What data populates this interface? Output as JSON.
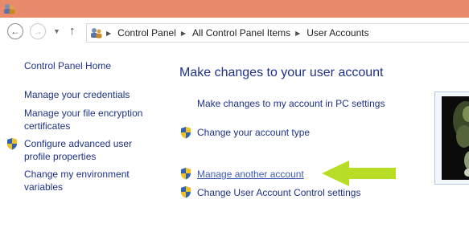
{
  "address": {
    "breadcrumb": [
      "Control Panel",
      "All Control Panel Items",
      "User Accounts"
    ]
  },
  "icons": {
    "titlebar": "user-accounts-icon",
    "back": "back-arrow-icon",
    "forward": "forward-arrow-icon",
    "recent": "chevron-down-icon",
    "up": "up-arrow-icon",
    "shield": "uac-shield-icon",
    "annotation": "green-arrow-icon"
  },
  "sidebar": {
    "home": "Control Panel Home",
    "items": [
      {
        "label": "Manage your credentials"
      },
      {
        "label": "Manage your file encryption certificates"
      },
      {
        "label": "Configure advanced user profile properties"
      },
      {
        "label": "Change my environment variables"
      }
    ]
  },
  "main": {
    "title": "Make changes to your user account",
    "links": [
      {
        "label": "Make changes to my account in PC settings"
      },
      {
        "label": "Change your account type"
      },
      {
        "label": "Manage another account"
      },
      {
        "label": "Change User Account Control settings"
      }
    ]
  },
  "colors": {
    "titlebar": "#ea8a6d",
    "link": "#1e3287",
    "annotation_arrow": "#b7de24"
  }
}
